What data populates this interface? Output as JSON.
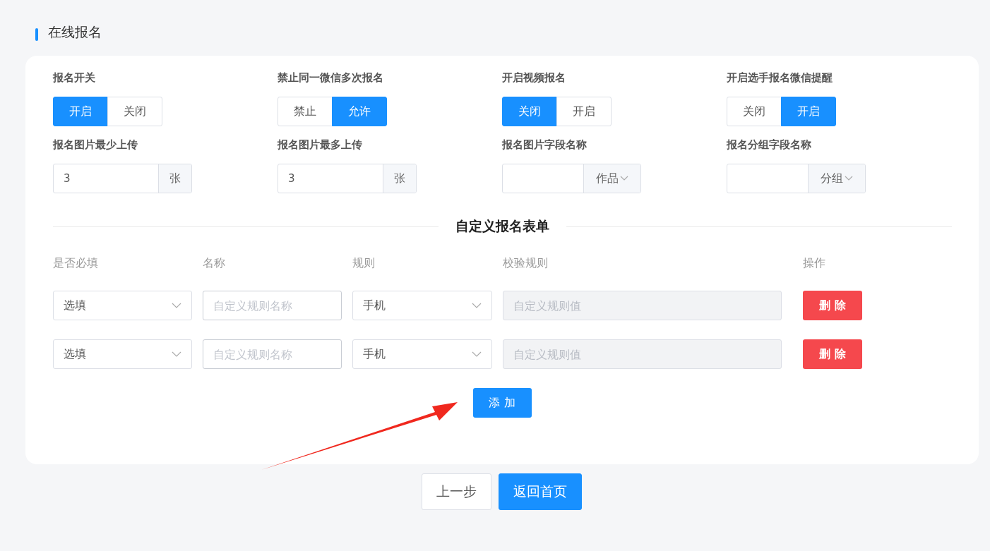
{
  "section_title": "在线报名",
  "toggles": [
    {
      "label": "报名开关",
      "options": [
        {
          "label": "开启",
          "selected": true
        },
        {
          "label": "关闭",
          "selected": false
        }
      ]
    },
    {
      "label": "禁止同一微信多次报名",
      "options": [
        {
          "label": "禁止",
          "selected": false
        },
        {
          "label": "允许",
          "selected": true
        }
      ]
    },
    {
      "label": "开启视频报名",
      "options": [
        {
          "label": "关闭",
          "selected": true
        },
        {
          "label": "开启",
          "selected": false
        }
      ]
    },
    {
      "label": "开启选手报名微信提醒",
      "options": [
        {
          "label": "关闭",
          "selected": false
        },
        {
          "label": "开启",
          "selected": true
        }
      ]
    }
  ],
  "uploads": [
    {
      "label": "报名图片最少上传",
      "kind": "number",
      "value": "3",
      "suffix": "张"
    },
    {
      "label": "报名图片最多上传",
      "kind": "number",
      "value": "3",
      "suffix": "张"
    },
    {
      "label": "报名图片字段名称",
      "kind": "select",
      "suffix": "作品"
    },
    {
      "label": "报名分组字段名称",
      "kind": "select",
      "suffix": "分组"
    }
  ],
  "form_title": "自定义报名表单",
  "columns": [
    "是否必填",
    "名称",
    "规则",
    "校验规则",
    "操作"
  ],
  "rows": [
    {
      "required": "选填",
      "name_placeholder": "自定义规则名称",
      "rule": "手机",
      "check_placeholder": "自定义规则值",
      "check_disabled": true,
      "delete": "删 除"
    },
    {
      "required": "选填",
      "name_placeholder": "自定义规则名称",
      "rule": "手机",
      "check_placeholder": "自定义规则值",
      "check_disabled": true,
      "delete": "删 除"
    }
  ],
  "add_button": "添 加",
  "footer_buttons": [
    {
      "label": "上一步",
      "kind": "default"
    },
    {
      "label": "返回首页",
      "kind": "primary"
    }
  ]
}
